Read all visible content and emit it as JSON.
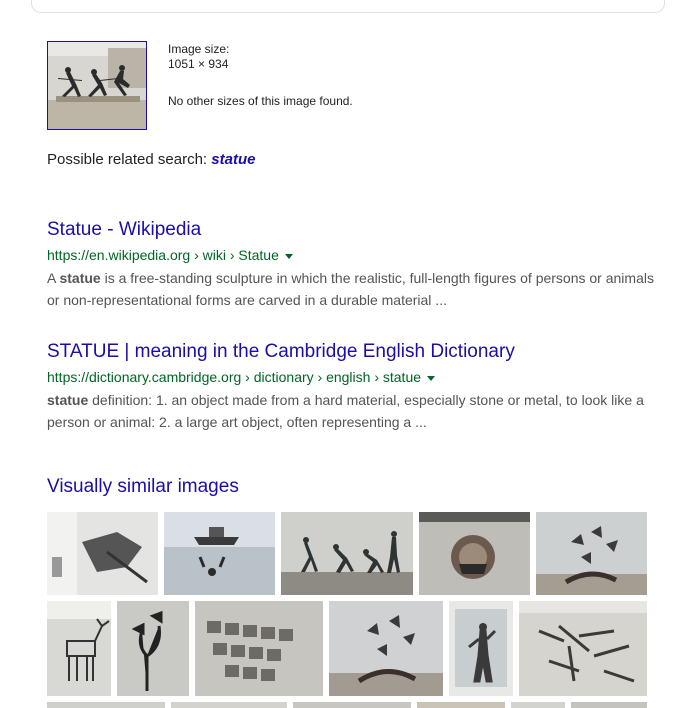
{
  "image_info": {
    "size_label": "Image size:",
    "size_value": "1051 × 934",
    "other_sizes": "No other sizes of this image found."
  },
  "related_search": {
    "label": "Possible related search:",
    "term": "statue"
  },
  "results": [
    {
      "title": "Statue - Wikipedia",
      "url": "https://en.wikipedia.org › wiki › Statue",
      "snippet_pre": "A ",
      "snippet_bold": "statue",
      "snippet_post": " is a free-standing sculpture in which the realistic, full-length figures of persons or animals or non-representational forms are carved in a durable material ..."
    },
    {
      "title": "STATUE | meaning in the Cambridge English Dictionary",
      "url": "https://dictionary.cambridge.org › dictionary › english › statue",
      "snippet_pre": "",
      "snippet_bold": "statue",
      "snippet_post": " definition: 1. an object made from a hard material, especially stone or metal, to look like a person or animal: 2. a large art object, often representing a ..."
    }
  ],
  "similar": {
    "title": "Visually similar images"
  },
  "colors": {
    "link": "#1a0dab",
    "url": "#006621",
    "snippet": "#545454"
  }
}
